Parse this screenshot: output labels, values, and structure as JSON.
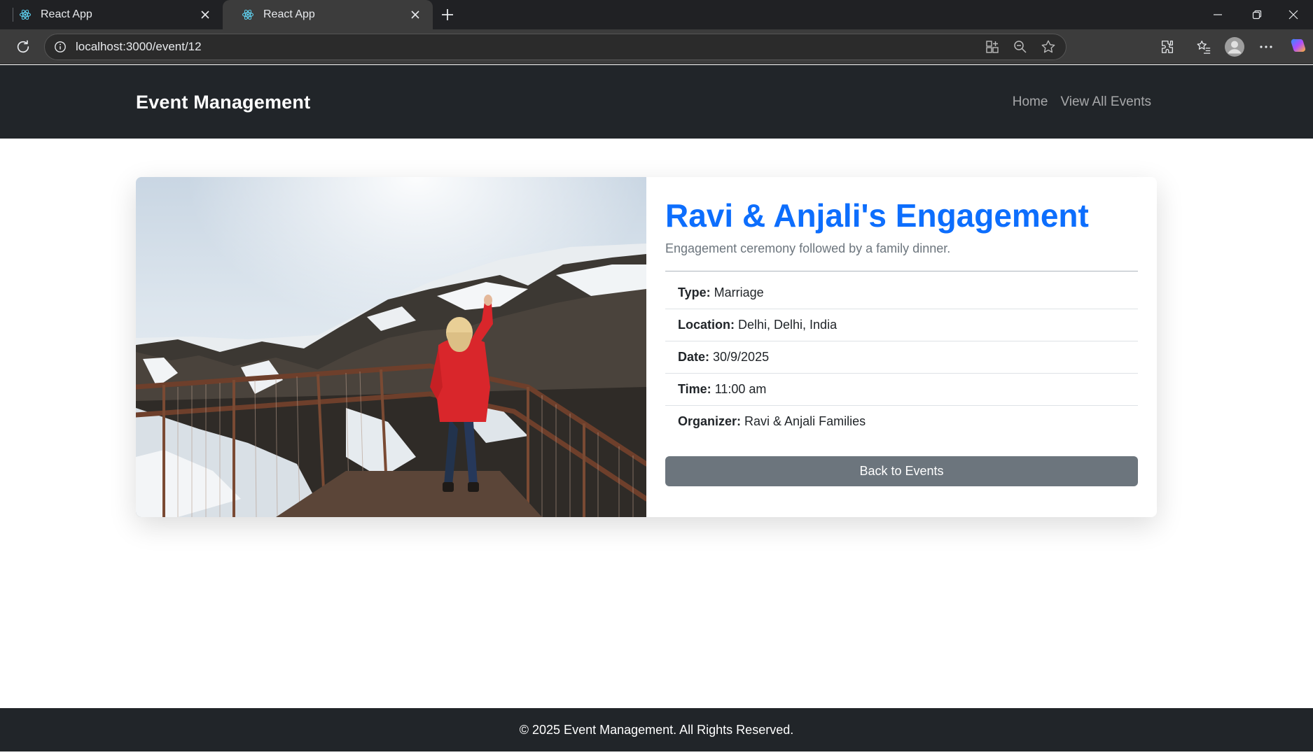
{
  "browser": {
    "tabs": [
      {
        "title": "React App",
        "icon": "react-icon",
        "active": false
      },
      {
        "title": "React App",
        "icon": "react-icon",
        "active": true
      }
    ],
    "url": "localhost:3000/event/12"
  },
  "navbar": {
    "brand": "Event Management",
    "links": [
      "Home",
      "View All Events"
    ]
  },
  "event": {
    "title": "Ravi & Anjali's Engagement",
    "description": "Engagement ceremony followed by a family dinner.",
    "details": [
      {
        "label": "Type:",
        "value": "Marriage"
      },
      {
        "label": "Location:",
        "value": "Delhi, Delhi, India"
      },
      {
        "label": "Date:",
        "value": "30/9/2025"
      },
      {
        "label": "Time:",
        "value": "11:00 am"
      },
      {
        "label": "Organizer:",
        "value": "Ravi & Anjali Families"
      }
    ],
    "back_button": "Back to Events"
  },
  "footer": {
    "text": "© 2025 Event Management. All Rights Reserved."
  },
  "colors": {
    "accent": "#0d6efd",
    "navbar_bg": "#212529",
    "button_bg": "#6c757d"
  }
}
